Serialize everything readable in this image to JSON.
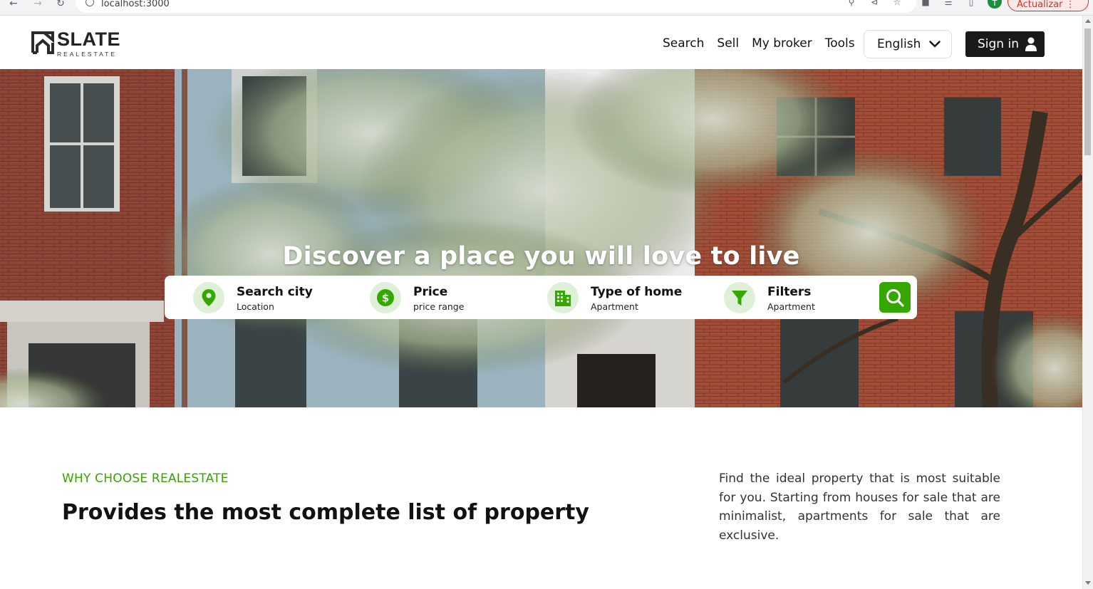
{
  "browser": {
    "url": "localhost:3000",
    "update_label": "Actualizar",
    "profile_initial": "T"
  },
  "header": {
    "logo_main": "SLATE",
    "logo_sub": "REALESTATE",
    "nav": [
      {
        "label": "Search"
      },
      {
        "label": "Sell"
      },
      {
        "label": "My broker"
      },
      {
        "label": "Tools"
      }
    ],
    "language": "English",
    "signin_label": "Sign in"
  },
  "hero": {
    "title": "Discover a place you will love to live",
    "search": [
      {
        "title": "Search city",
        "subtitle": "Location",
        "icon": "location-pin-icon"
      },
      {
        "title": "Price",
        "subtitle": "price range",
        "icon": "dollar-icon"
      },
      {
        "title": "Type of home",
        "subtitle": "Apartment",
        "icon": "building-icon"
      },
      {
        "title": "Filters",
        "subtitle": "Apartment",
        "icon": "filter-icon"
      }
    ],
    "search_button_icon": "search-icon"
  },
  "why": {
    "eyebrow": "WHY CHOOSE REALESTATE",
    "title": "Provides the most complete list of property",
    "description": "Find the ideal property that is most suitable for you. Starting from houses for sale that are minimalist, apartments for sale that are exclusive."
  },
  "colors": {
    "accent": "#36a600",
    "accent_light": "#dff0d8",
    "dark_button": "#1a1a1a"
  }
}
